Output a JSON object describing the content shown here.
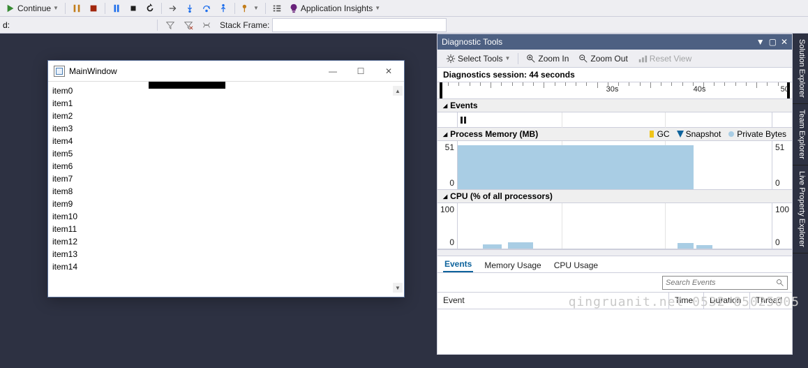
{
  "toolbar": {
    "continue": "Continue",
    "app_insights": "Application Insights",
    "find_label": "d:",
    "stack_frame_label": "Stack Frame:"
  },
  "mainwindow": {
    "title": "MainWindow",
    "items": [
      "item0",
      "item1",
      "item2",
      "item3",
      "item4",
      "item5",
      "item6",
      "item7",
      "item8",
      "item9",
      "item10",
      "item11",
      "item12",
      "item13",
      "item14"
    ]
  },
  "side_tabs": [
    "Solution Explorer",
    "Team Explorer",
    "Live Property Explorer"
  ],
  "diag": {
    "title": "Diagnostic Tools",
    "select_tools": "Select Tools",
    "zoom_in": "Zoom In",
    "zoom_out": "Zoom Out",
    "reset_view": "Reset View",
    "session": "Diagnostics session: 44 seconds",
    "ruler_labels": [
      {
        "t": "30s",
        "pos": 58
      },
      {
        "t": "40s",
        "pos": 88
      },
      {
        "t": "50",
        "pos": 118
      }
    ],
    "events_label": "Events",
    "memory_label": "Process Memory (MB)",
    "cpu_label": "CPU (% of all processors)",
    "legend_gc": "GC",
    "legend_snapshot": "Snapshot",
    "legend_private": "Private Bytes",
    "tabs": [
      "Events",
      "Memory Usage",
      "CPU Usage"
    ],
    "search_placeholder": "Search Events",
    "cols": {
      "event": "Event",
      "time": "Time",
      "duration": "Duration",
      "thread": "Thread"
    }
  },
  "chart_data": [
    {
      "type": "area",
      "name": "Process Memory (MB)",
      "ylim": [
        0,
        51
      ],
      "x_range_s": [
        26,
        50
      ],
      "series": [
        {
          "name": "Private Bytes",
          "approx_constant_value": 48,
          "fill_until_s": 44
        }
      ]
    },
    {
      "type": "area",
      "name": "CPU (% of all processors)",
      "ylim": [
        0,
        100
      ],
      "x_range_s": [
        26,
        50
      ],
      "series": [
        {
          "name": "CPU",
          "spikes": [
            {
              "at_s": 29,
              "pct": 8
            },
            {
              "at_s": 31,
              "pct": 12
            },
            {
              "at_s": 44,
              "pct": 10
            },
            {
              "at_s": 45,
              "pct": 7
            }
          ]
        }
      ]
    }
  ],
  "watermark": "qingruanit.net 0532-85025005"
}
